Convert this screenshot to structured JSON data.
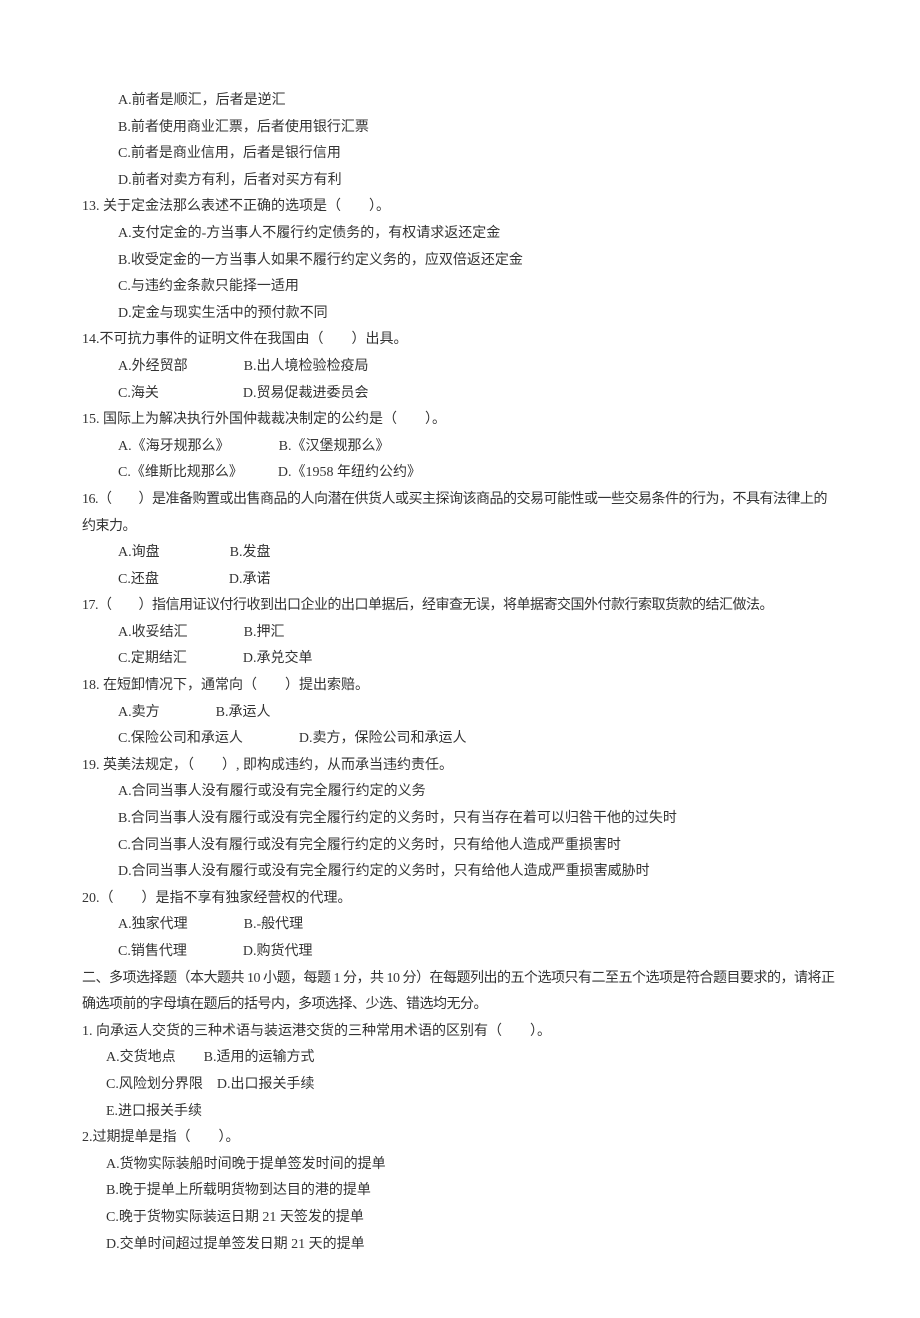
{
  "q12opts": {
    "a": "A.前者是顺汇，后者是逆汇",
    "b": "B.前者使用商业汇票，后者使用银行汇票",
    "c": "C.前者是商业信用，后者是银行信用",
    "d": "D.前者对卖方有利，后者对买方有利"
  },
  "q13": {
    "stem": "13. 关于定金法那么表述不正确的选项是（　　）。",
    "a": "A.支付定金的-方当事人不履行约定债务的，有权请求返还定金",
    "b": "B.收受定金的一方当事人如果不履行约定义务的，应双倍返还定金",
    "c": "C.与违约金条款只能择一适用",
    "d": "D.定金与现实生活中的预付款不同"
  },
  "q14": {
    "stem": "14.不可抗力事件的证明文件在我国由（　　）出具。",
    "row1": "A.外经贸部　　　　B.出人境检验检疫局",
    "row2": "C.海关　　　　　　D.贸易促裁进委员会"
  },
  "q15": {
    "stem": "15. 国际上为解决执行外国仲裁裁决制定的公约是（　　）。",
    "row1": "A.《海牙规那么》　　　　B.《汉堡规那么》",
    "row2": "C.《维斯比规那么》　　　D.《1958 年纽约公约》"
  },
  "q16": {
    "stem": "16.（　　）是准备购置或出售商品的人向潜在供货人或买主探询该商品的交易可能性或一些交易条件的行为，不具有法律上的约束力。",
    "row1": "A.询盘　　　　　B.发盘",
    "row2": "C.还盘　　　　　D.承诺"
  },
  "q17": {
    "stem": "17.（　　）指信用证议付行收到出口企业的出口单据后，经审查无误，将单据寄交国外付款行索取货款的结汇做法。",
    "row1": "A.收妥结汇　　　　B.押汇",
    "row2": "C.定期结汇　　　　D.承兑交单"
  },
  "q18": {
    "stem": "18. 在短卸情况下，通常向（　　）提出索赔。",
    "row1": "A.卖方　　　　B.承运人",
    "row2": "C.保险公司和承运人　　　　D.卖方，保险公司和承运人"
  },
  "q19": {
    "stem": "19. 英美法规定，（　　）, 即构成违约，从而承当违约责任。",
    "a": "A.合同当事人没有履行或没有完全履行约定的义务",
    "b": "B.合同当事人没有履行或没有完全履行约定的义务时，只有当存在着可以归咎干他的过失时",
    "c": "C.合同当事人没有履行或没有完全履行约定的义务时，只有给他人造成严重损害时",
    "d": "D.合同当事人没有履行或没有完全履行约定的义务时，只有给他人造成严重损害威胁时"
  },
  "q20": {
    "stem": "20.（　　）是指不享有独家经营权的代理。",
    "row1": "A.独家代理　　　　B.-般代理",
    "row2": "C.销售代理　　　　D.购货代理"
  },
  "section2": {
    "header": "二、多项选择题（本大题共 10 小题，每题 1 分，共 10 分）在每题列出的五个选项只有二至五个选项是符合题目要求的，请将正确选项前的字母填在题后的括号内，多项选择、少选、错选均无分。"
  },
  "m1": {
    "stem": "1. 向承运人交货的三种术语与装运港交货的三种常用术语的区别有（　　）。",
    "row1": "A.交货地点　　B.适用的运输方式",
    "row2": "C.风险划分界限　D.出口报关手续",
    "row3": "E.进口报关手续"
  },
  "m2": {
    "stem": "2.过期提单是指（　　）。",
    "a": "A.货物实际装船时间晚于提单签发时间的提单",
    "b": "B.晚于提单上所载明货物到达目的港的提单",
    "c": "C.晚于货物实际装运日期 21 天签发的提单",
    "d": "D.交单时间超过提单签发日期 21 天的提单"
  }
}
